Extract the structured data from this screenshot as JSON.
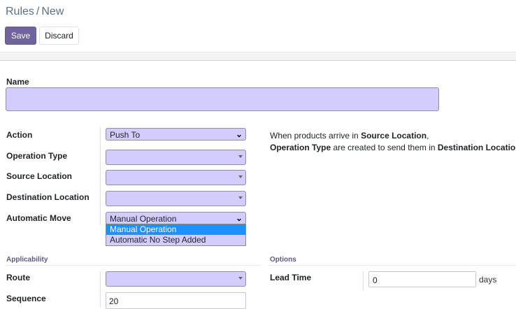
{
  "breadcrumb": {
    "parent": "Rules",
    "separator": "/",
    "current": "New"
  },
  "toolbar": {
    "save_label": "Save",
    "discard_label": "Discard"
  },
  "form": {
    "name_label": "Name",
    "name_value": "",
    "action": {
      "label": "Action",
      "value": "Push To"
    },
    "operation_type": {
      "label": "Operation Type",
      "value": ""
    },
    "source_location": {
      "label": "Source Location",
      "value": ""
    },
    "destination_location": {
      "label": "Destination Location",
      "value": ""
    },
    "automatic_move": {
      "label": "Automatic Move",
      "value": "Manual Operation",
      "options": [
        "Manual Operation",
        "Automatic No Step Added"
      ]
    },
    "help": {
      "line1_prefix": "When products arrive in ",
      "line1_bold": "Source Location",
      "line1_suffix": ",",
      "line2_bold1": "Operation Type",
      "line2_mid": " are created to send them in ",
      "line2_bold2": "Destination Location",
      "line2_suffix": "."
    }
  },
  "applicability": {
    "title": "Applicability",
    "route": {
      "label": "Route",
      "value": ""
    },
    "sequence": {
      "label": "Sequence",
      "value": "20"
    }
  },
  "options": {
    "title": "Options",
    "lead_time": {
      "label": "Lead Time",
      "value": "0",
      "unit": "days"
    }
  },
  "colors": {
    "primary": "#71639e",
    "field_bg": "#d2ccff",
    "highlight": "#1e90ff"
  },
  "icons": {
    "select_caret": "caret-down-icon",
    "select_chevron": "chevron-down-icon"
  }
}
